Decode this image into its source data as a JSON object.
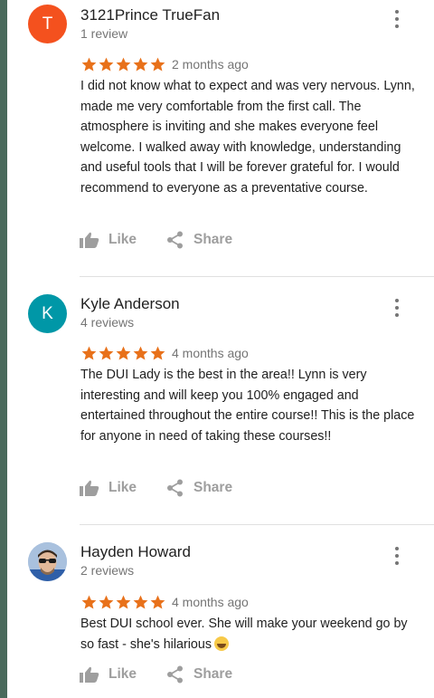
{
  "colors": {
    "star": "#e8711a",
    "avatar_t": "#f4511e",
    "avatar_k": "#0097a7",
    "action_gray": "#9e9e9e"
  },
  "reviews": [
    {
      "avatar_letter": "T",
      "name": "3121Prince TrueFan",
      "review_count": "1 review",
      "rating": 5,
      "date": "2 months ago",
      "text": "I did not know what to expect and was very nervous. Lynn, made me very comfortable from the first call. The atmosphere is inviting and she makes everyone feel welcome. I walked away with knowledge, understanding and useful tools that I will be forever grateful for. I would recommend to everyone as a preventative course.",
      "like_label": "Like",
      "share_label": "Share"
    },
    {
      "avatar_letter": "K",
      "name": "Kyle Anderson",
      "review_count": "4 reviews",
      "rating": 5,
      "date": "4 months ago",
      "text": "The DUI Lady is the best in the area!! Lynn is very interesting and will keep you 100% engaged and entertained throughout the entire course!! This is the place for anyone in need of taking these courses!!",
      "like_label": "Like",
      "share_label": "Share"
    },
    {
      "avatar_letter": "",
      "name": "Hayden Howard",
      "review_count": "2 reviews",
      "rating": 5,
      "date": "4 months ago",
      "text": "Best DUI school ever. She will make your weekend go by so fast - she's hilarious",
      "like_label": "Like",
      "share_label": "Share"
    }
  ]
}
